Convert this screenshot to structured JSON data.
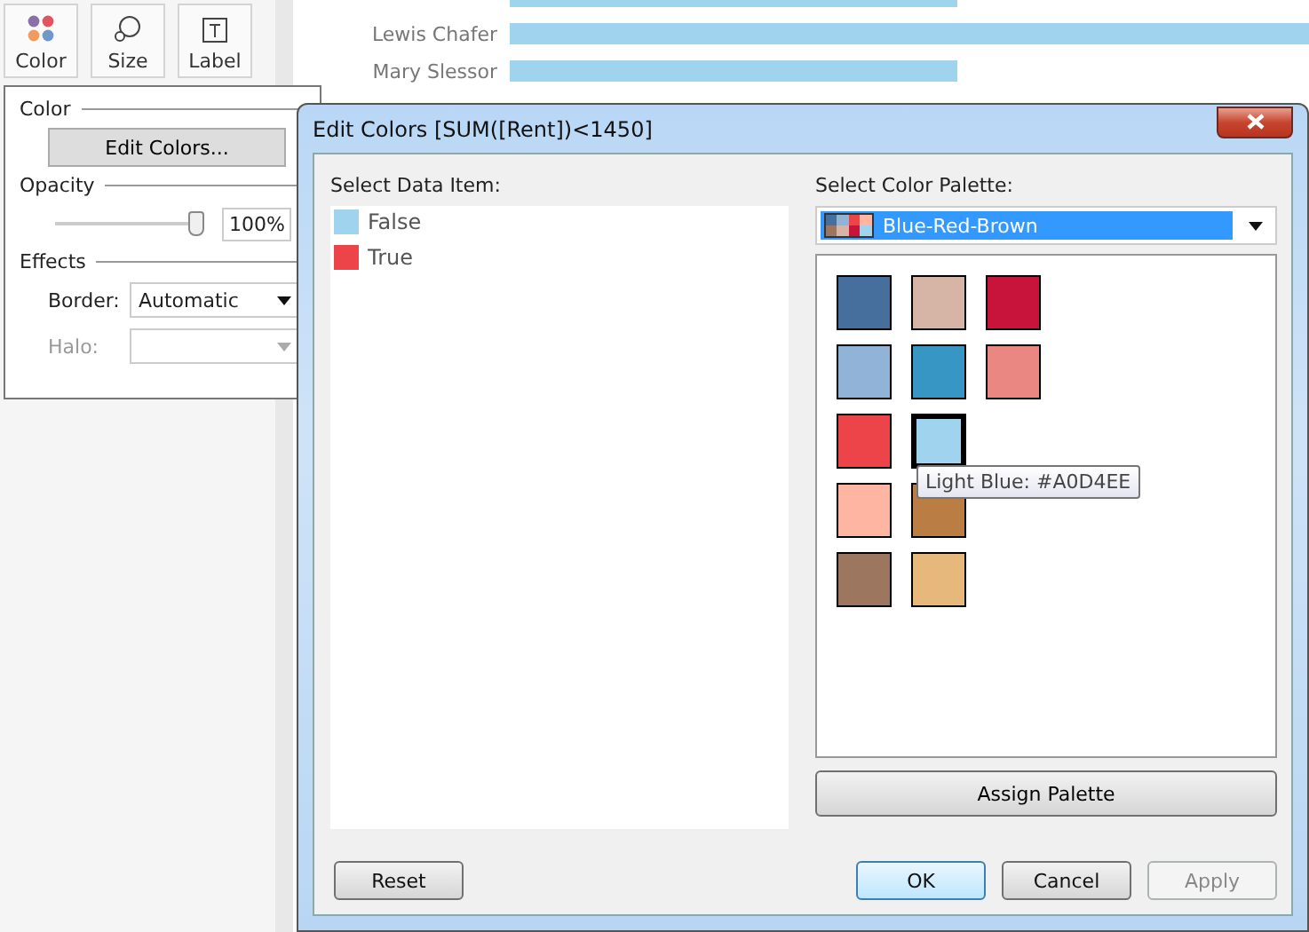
{
  "marks_toolbar": [
    {
      "kind": "color",
      "label": "Color"
    },
    {
      "kind": "size",
      "label": "Size"
    },
    {
      "kind": "label",
      "label": "Label"
    }
  ],
  "chart": {
    "rows": [
      {},
      {
        "name": "Lewis Chafer"
      },
      {
        "name": "Mary Slessor"
      }
    ]
  },
  "format_popup": {
    "color_heading": "Color",
    "edit_colors_button": "Edit Colors...",
    "opacity_heading": "Opacity",
    "opacity": {
      "level": 1,
      "reading": "100%"
    },
    "effects_heading": "Effects",
    "fields": [
      {
        "label": "Border:",
        "value": "Automatic",
        "disabled": false
      },
      {
        "label": "Halo:",
        "disabled": true
      }
    ]
  },
  "dialog": {
    "title": "Edit Colors [SUM([Rent])<1450]",
    "data_item_label": "Select Data Item:",
    "data_items": [
      {
        "label": "False",
        "color": "#a0d4ee"
      },
      {
        "label": "True",
        "color": "#ed444a"
      }
    ],
    "palette_label": "Select Color Palette:",
    "palette": "Blue-Red-Brown",
    "swatches": [
      {
        "color": "#466f9d",
        "selected": false
      },
      {
        "color": "#91b3d7",
        "selected": false
      },
      {
        "color": "#ed444a",
        "selected": false
      },
      {
        "color": "#feb5a2",
        "selected": false
      },
      {
        "color": "#9d7660",
        "selected": false
      },
      {
        "color": "#d7b5a6",
        "selected": false
      },
      {
        "color": "#3896c4",
        "selected": false
      },
      {
        "color": "#a0d4ee",
        "selected": true
      },
      {
        "color": "#ba7e45",
        "selected": false
      },
      {
        "color": "#e7b87c",
        "selected": false
      },
      {
        "color": "#c8133b",
        "selected": false
      },
      {
        "color": "#ea8783",
        "selected": false
      }
    ],
    "tooltip": "Light Blue: #A0D4EE",
    "assign_button": "Assign Palette",
    "buttons": [
      {
        "label": "Reset",
        "kind": "reset",
        "disabled": false
      },
      {
        "label": "OK",
        "kind": "default",
        "disabled": false
      },
      {
        "label": "Cancel",
        "kind": "normal",
        "disabled": false
      },
      {
        "label": "Apply",
        "kind": "normal",
        "disabled": true
      }
    ]
  }
}
